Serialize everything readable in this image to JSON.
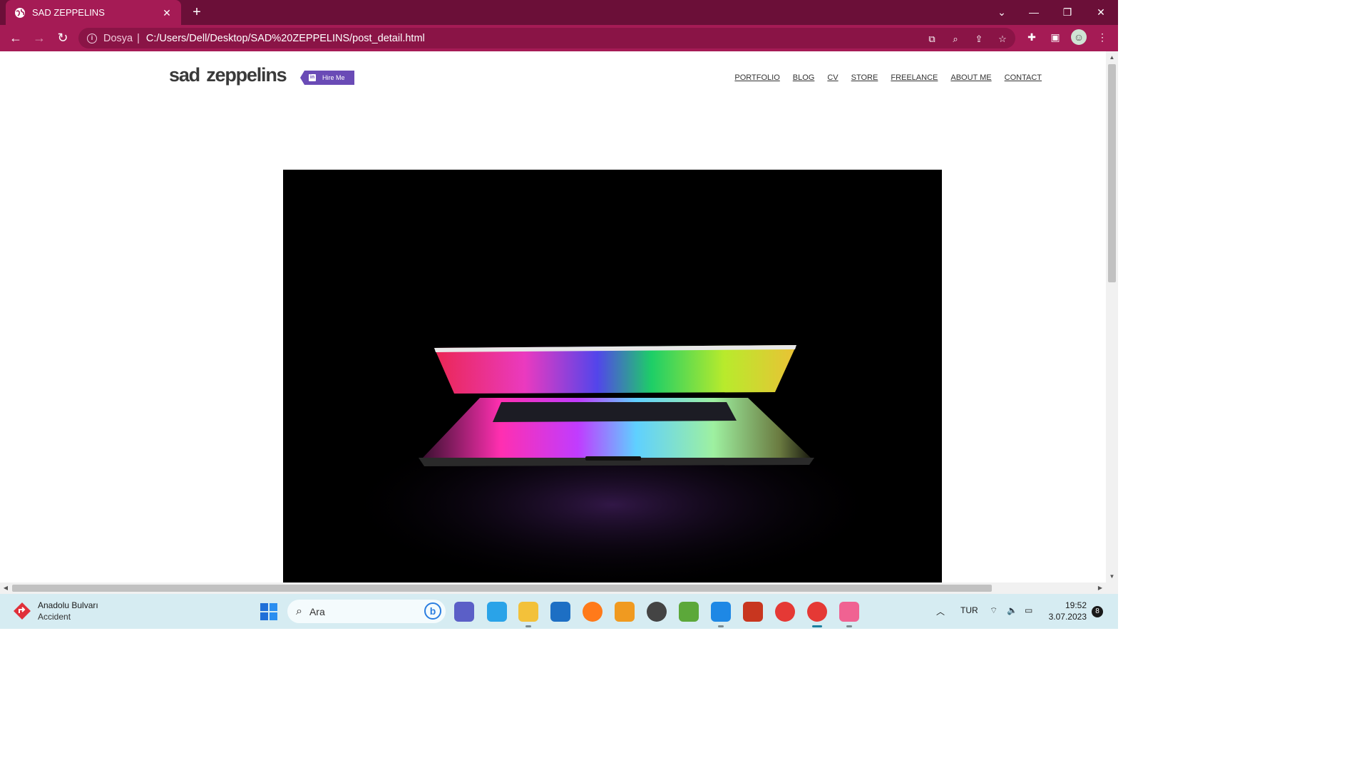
{
  "browser": {
    "tab_title": "SAD ZEPPELINS",
    "new_tab_symbol": "+",
    "address_scheme_label": "Dosya",
    "address_url": "C:/Users/Dell/Desktop/SAD%20ZEPPELINS/post_detail.html",
    "theme_colors": {
      "tabstrip": "#6b0f38",
      "toolbar": "#a51b55"
    }
  },
  "site": {
    "logo": "sad zeppelins",
    "hire_label": "Hire Me",
    "nav": [
      "PORTFOLIO",
      "BLOG",
      "CV",
      "STORE",
      "FREELANCE",
      "ABOUT ME",
      "CONTACT"
    ],
    "accent_color": "#6a4bb6"
  },
  "hero_image": {
    "subject": "laptop-rainbow-glow-icon"
  },
  "taskbar": {
    "weather_title": "Anadolu Bulvarı",
    "weather_subtitle": "Accident",
    "search_placeholder": "Ara",
    "language": "TUR",
    "time": "19:52",
    "date": "3.07.2023",
    "notification_count": "8"
  }
}
